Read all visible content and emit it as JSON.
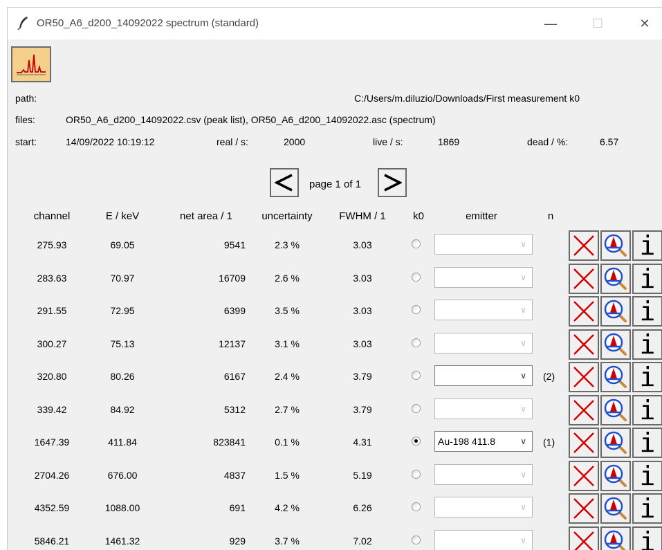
{
  "window": {
    "title": "OR50_A6_d200_14092022 spectrum (standard)",
    "controls": {
      "minimize": "—",
      "maximize": "☐",
      "close": "✕"
    }
  },
  "toolbar": {
    "plot_icon": "spectrum-plot-icon"
  },
  "info": {
    "path_label": "path:",
    "path_value": "C:/Users/m.diluzio/Downloads/First measurement k0",
    "files_label": "files:",
    "files_value": "OR50_A6_d200_14092022.csv (peak list), OR50_A6_d200_14092022.asc (spectrum)",
    "start_label": "start:",
    "start_value": "14/09/2022 10:19:12",
    "real_label": "real / s:",
    "real_value": "2000",
    "live_label": "live / s:",
    "live_value": "1869",
    "dead_label": "dead / %:",
    "dead_value": "6.57"
  },
  "pagination": {
    "prev": "<",
    "next": ">",
    "label": "page 1 of 1"
  },
  "table": {
    "headers": {
      "channel": "channel",
      "energy": "E / keV",
      "net_area": "net area / 1",
      "uncertainty": "uncertainty",
      "fwhm": "FWHM / 1",
      "k0": "k0",
      "emitter": "emitter",
      "n": "n"
    },
    "rows": [
      {
        "channel": "275.93",
        "energy": "69.05",
        "net_area": "9541",
        "uncertainty": "2.3 %",
        "fwhm": "3.03",
        "k0_selected": false,
        "emitter": "",
        "emitter_active": false,
        "n": ""
      },
      {
        "channel": "283.63",
        "energy": "70.97",
        "net_area": "16709",
        "uncertainty": "2.6 %",
        "fwhm": "3.03",
        "k0_selected": false,
        "emitter": "",
        "emitter_active": false,
        "n": ""
      },
      {
        "channel": "291.55",
        "energy": "72.95",
        "net_area": "6399",
        "uncertainty": "3.5 %",
        "fwhm": "3.03",
        "k0_selected": false,
        "emitter": "",
        "emitter_active": false,
        "n": ""
      },
      {
        "channel": "300.27",
        "energy": "75.13",
        "net_area": "12137",
        "uncertainty": "3.1 %",
        "fwhm": "3.03",
        "k0_selected": false,
        "emitter": "",
        "emitter_active": false,
        "n": ""
      },
      {
        "channel": "320.80",
        "energy": "80.26",
        "net_area": "6167",
        "uncertainty": "2.4 %",
        "fwhm": "3.79",
        "k0_selected": false,
        "emitter": "",
        "emitter_active": true,
        "n": "(2)"
      },
      {
        "channel": "339.42",
        "energy": "84.92",
        "net_area": "5312",
        "uncertainty": "2.7 %",
        "fwhm": "3.79",
        "k0_selected": false,
        "emitter": "",
        "emitter_active": false,
        "n": ""
      },
      {
        "channel": "1647.39",
        "energy": "411.84",
        "net_area": "823841",
        "uncertainty": "0.1 %",
        "fwhm": "4.31",
        "k0_selected": true,
        "emitter": "Au-198 411.8",
        "emitter_active": true,
        "n": "(1)"
      },
      {
        "channel": "2704.26",
        "energy": "676.00",
        "net_area": "4837",
        "uncertainty": "1.5 %",
        "fwhm": "5.19",
        "k0_selected": false,
        "emitter": "",
        "emitter_active": false,
        "n": ""
      },
      {
        "channel": "4352.59",
        "energy": "1088.00",
        "net_area": "691",
        "uncertainty": "4.2 %",
        "fwhm": "6.26",
        "k0_selected": false,
        "emitter": "",
        "emitter_active": false,
        "n": ""
      },
      {
        "channel": "5846.21",
        "energy": "1461.32",
        "net_area": "929",
        "uncertainty": "3.7 %",
        "fwhm": "7.02",
        "k0_selected": false,
        "emitter": "",
        "emitter_active": false,
        "n": ""
      }
    ],
    "row_actions": {
      "delete": "delete-icon",
      "inspect": "peak-zoom-icon",
      "info": "i"
    }
  },
  "colors": {
    "accent_red": "#d00000",
    "plot_button_bg": "#f5d08c",
    "zoom_blue": "#1f4fd1"
  }
}
